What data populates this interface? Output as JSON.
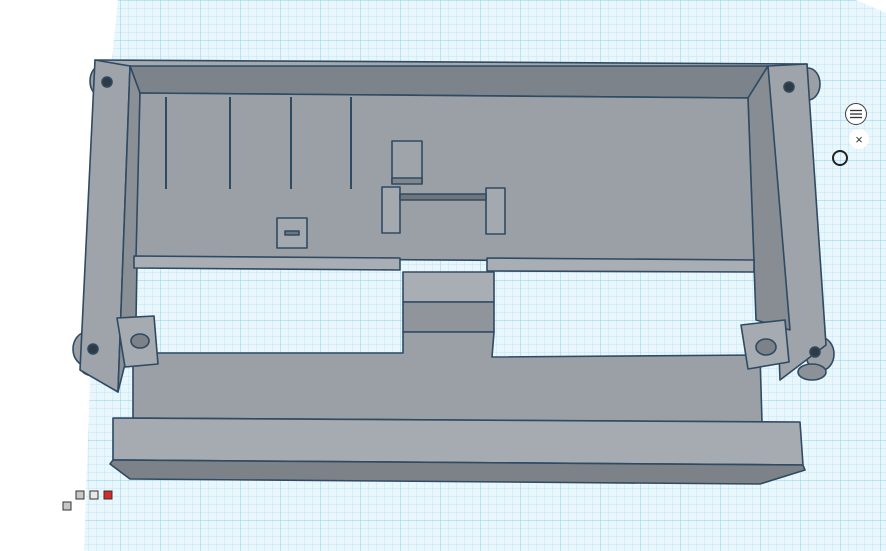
{
  "viewport": {
    "background_color": "#ffffff",
    "grid_color": "#bfe6f7",
    "grid_major_color": "#8ccfee",
    "model_color": "#9aa0a6",
    "model_shadow_color": "#7f858b",
    "model_outline_color": "#2f4a63"
  },
  "controls": {
    "menu_icon": "list-icon",
    "close_icon": "close-icon",
    "close_glyph": "×",
    "ring_icon": "circle-icon"
  },
  "view_cube": {
    "icon": "view-cube-icon",
    "accent_color": "#d62b2b"
  }
}
